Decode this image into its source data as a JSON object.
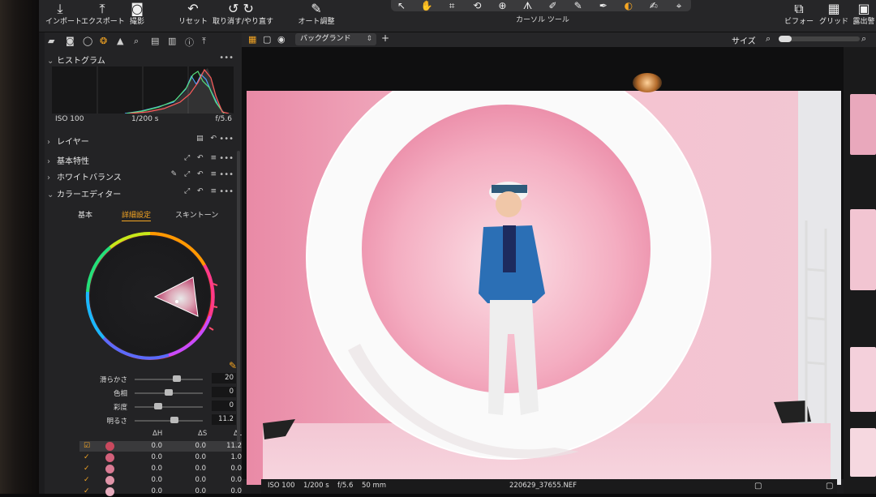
{
  "toolbar": {
    "import": "インポート",
    "export": "エクスポート",
    "capture": "撮影",
    "reset": "リセット",
    "undo_redo": "取り消す/やり直す",
    "auto_adjust": "オート調整",
    "cursor_tools": "カーソル ツール",
    "viewer": "ビフォー",
    "grid": "グリッド",
    "exposure_warning": "露出警"
  },
  "histogram": {
    "title": "ヒストグラム",
    "iso": "ISO 100",
    "shutter": "1/200 s",
    "aperture": "f/5.6"
  },
  "layers": {
    "title": "レイヤー"
  },
  "sections": {
    "basic": "基本特性",
    "white_balance": "ホワイトバランス",
    "color_editor": "カラーエディター"
  },
  "color_editor": {
    "tabs": [
      "基本",
      "詳細設定",
      "スキントーン"
    ],
    "active_tab": 1,
    "sliders": [
      {
        "name": "滑らかさ",
        "value": "20",
        "fraction": 0.62
      },
      {
        "name": "色相",
        "value": "0",
        "fraction": 0.5
      },
      {
        "name": "彩度",
        "value": "0",
        "fraction": 0.35
      },
      {
        "name": "明るさ",
        "value": "11.2",
        "fraction": 0.58
      }
    ],
    "table": {
      "headers": [
        "ΔH",
        "ΔS",
        "ΔL"
      ],
      "rows": [
        {
          "h": "0.0",
          "s": "0.0",
          "l": "11.2",
          "color": "#c9495e"
        },
        {
          "h": "0.0",
          "s": "0.0",
          "l": "1.0",
          "color": "#d2607a"
        },
        {
          "h": "0.0",
          "s": "0.0",
          "l": "0.0",
          "color": "#d97a93"
        },
        {
          "h": "0.0",
          "s": "0.0",
          "l": "0.0",
          "color": "#e094a8"
        },
        {
          "h": "0.0",
          "s": "0.0",
          "l": "0.0",
          "color": "#e6acbd"
        }
      ]
    }
  },
  "viewer": {
    "background_select": "バックグランド",
    "size_label": "サイズ"
  },
  "status": {
    "iso": "ISO 100",
    "shutter": "1/200 s",
    "aperture": "f/5.6",
    "focal": "50 mm",
    "filename": "220629_37655.NEF"
  },
  "colors": {
    "accent": "#f5a623",
    "panel": "#232325",
    "backdrop": "#f1b8c8"
  }
}
